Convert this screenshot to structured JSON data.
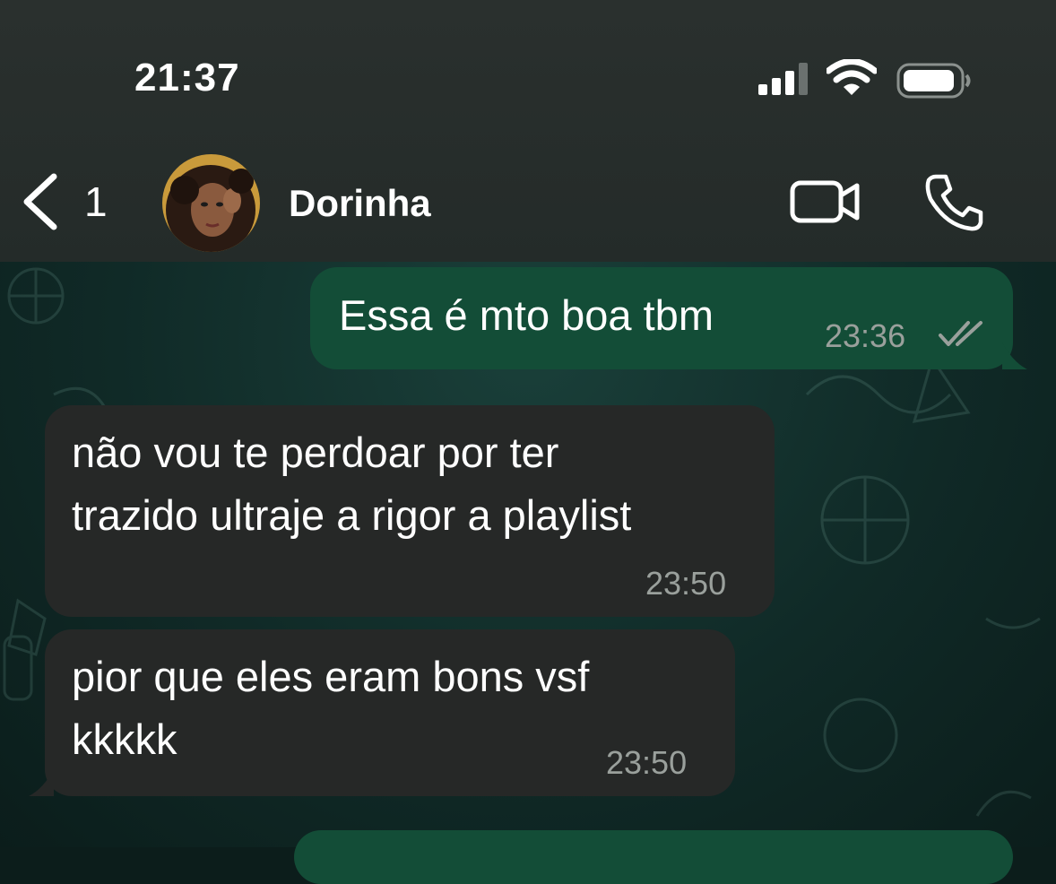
{
  "status_bar": {
    "time": "21:37"
  },
  "header": {
    "back_count": "1",
    "contact_name": "Dorinha"
  },
  "messages": [
    {
      "direction": "outgoing",
      "text": "Essa é mto boa tbm",
      "time": "23:36",
      "status": "read"
    },
    {
      "direction": "incoming",
      "text": "não vou te perdoar por ter\ntrazido ultraje a rigor a playlist",
      "time": "23:50"
    },
    {
      "direction": "incoming",
      "text": "pior que eles eram bons vsf\nkkkkk",
      "time": "23:50"
    }
  ],
  "colors": {
    "header_bg": "#262c2a",
    "outgoing_bubble": "#134d37",
    "incoming_bubble": "#262827",
    "timestamp": "#9aa09c"
  },
  "icons": [
    "back-chevron-icon",
    "video-call-icon",
    "phone-icon",
    "signal-icon",
    "wifi-icon",
    "battery-icon"
  ]
}
